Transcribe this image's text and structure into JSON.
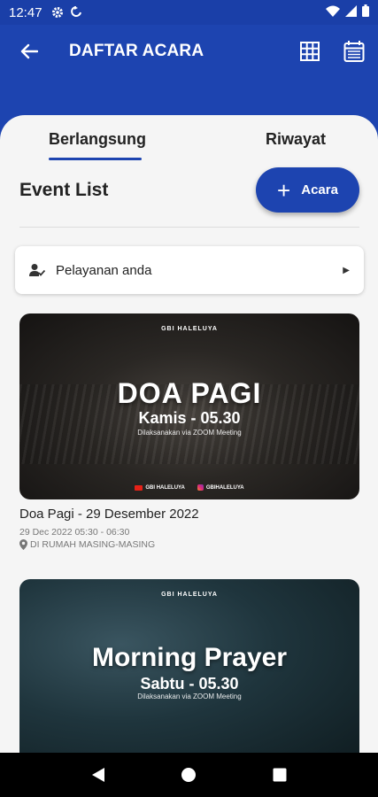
{
  "status_bar": {
    "time": "12:47"
  },
  "app_bar": {
    "title": "DAFTAR ACARA"
  },
  "tabs": [
    {
      "label": "Berlangsung",
      "active": true
    },
    {
      "label": "Riwayat",
      "active": false
    }
  ],
  "list": {
    "title": "Event List",
    "add_button_label": "Acara"
  },
  "service_row": {
    "label": "Pelayanan anda"
  },
  "events": [
    {
      "poster": {
        "logo": "GBI HALELUYA",
        "heading": "DOA PAGI",
        "subheading": "Kamis - 05.30",
        "note": "Dilaksanakan via ZOOM Meeting",
        "youtube": "GBI HALELUYA",
        "instagram": "GBIHALELUYA"
      },
      "title": "Doa Pagi - 29 Desember 2022",
      "datetime": "29 Dec 2022 05:30 - 06:30",
      "location": "DI RUMAH MASING-MASING"
    },
    {
      "poster": {
        "logo": "GBI HALELUYA",
        "heading": "Morning Prayer",
        "subheading": "Sabtu - 05.30",
        "note": "Dilaksanakan via ZOOM Meeting"
      }
    }
  ],
  "colors": {
    "primary": "#1d44b0",
    "background": "#f5f5f5"
  },
  "icons": {
    "status": [
      "gear-icon",
      "sync-icon",
      "wifi-icon",
      "signal-icon",
      "battery-icon"
    ],
    "app_bar": [
      "back-arrow-icon",
      "grid-icon",
      "calendar-icon"
    ],
    "nav": [
      "back-triangle-icon",
      "home-circle-icon",
      "recents-square-icon"
    ]
  }
}
